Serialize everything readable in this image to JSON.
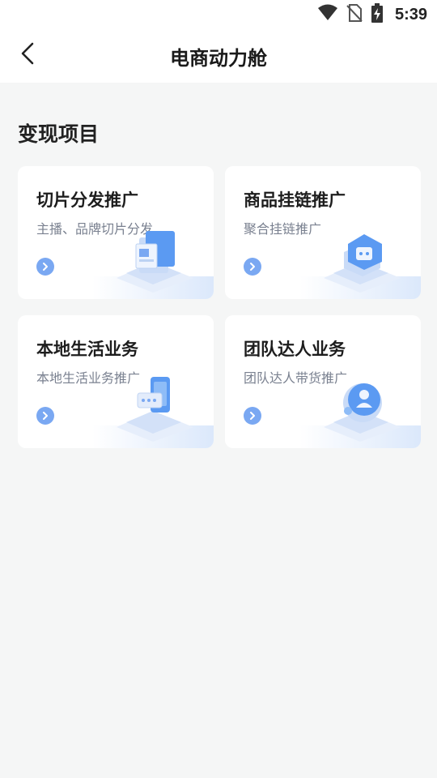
{
  "status": {
    "time": "5:39",
    "icons": [
      "wifi-icon",
      "no-sim-icon",
      "battery-charging-icon"
    ]
  },
  "header": {
    "back_icon": "chevron-left-icon",
    "title": "电商动力舱"
  },
  "section": {
    "title": "变现项目"
  },
  "cards": [
    {
      "title": "切片分发推广",
      "subtitle": "主播、品牌切片分发",
      "icon": "clips-illustration-icon"
    },
    {
      "title": "商品挂链推广",
      "subtitle": "聚合挂链推广",
      "icon": "shop-illustration-icon"
    },
    {
      "title": "本地生活业务",
      "subtitle": "本地生活业务推广",
      "icon": "local-life-illustration-icon"
    },
    {
      "title": "团队达人业务",
      "subtitle": "团队达人带货推广",
      "icon": "team-illustration-icon"
    }
  ],
  "colors": {
    "accent": "#7aa8f2",
    "background": "#f5f6f6",
    "card": "#ffffff"
  }
}
